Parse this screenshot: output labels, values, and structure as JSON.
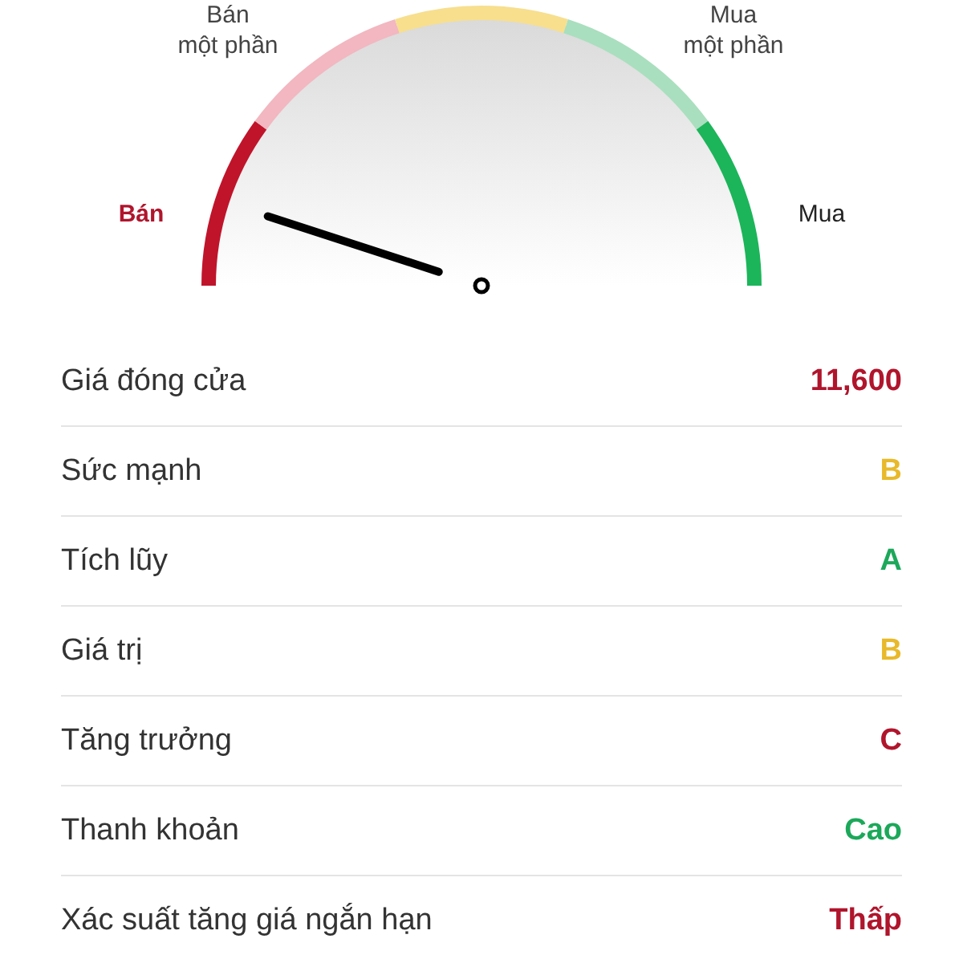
{
  "gauge": {
    "zones": [
      {
        "label": "Bán",
        "color": "#c0142b",
        "selected": true
      },
      {
        "label": "Bán\nmột phần",
        "color": "#f2b7c0",
        "selected": false
      },
      {
        "color": "#f7df8e",
        "selected": false
      },
      {
        "label": "Mua\nmột phần",
        "color": "#a9dfbe",
        "selected": false
      },
      {
        "label": "Mua",
        "color": "#1cb55a",
        "selected": false
      }
    ]
  },
  "rows": [
    {
      "label": "Giá đóng cửa",
      "value": "11,600",
      "color": "#b0152c"
    },
    {
      "label": "Sức mạnh",
      "value": "B",
      "color": "#e8b92a"
    },
    {
      "label": "Tích lũy",
      "value": "A",
      "color": "#1ca85a"
    },
    {
      "label": "Giá trị",
      "value": "B",
      "color": "#e8b92a"
    },
    {
      "label": "Tăng trưởng",
      "value": "C",
      "color": "#b0152c"
    },
    {
      "label": "Thanh khoản",
      "value": "Cao",
      "color": "#1ca85a"
    },
    {
      "label": "Xác suất tăng giá ngắn hạn",
      "value": "Thấp",
      "color": "#b0152c"
    }
  ]
}
